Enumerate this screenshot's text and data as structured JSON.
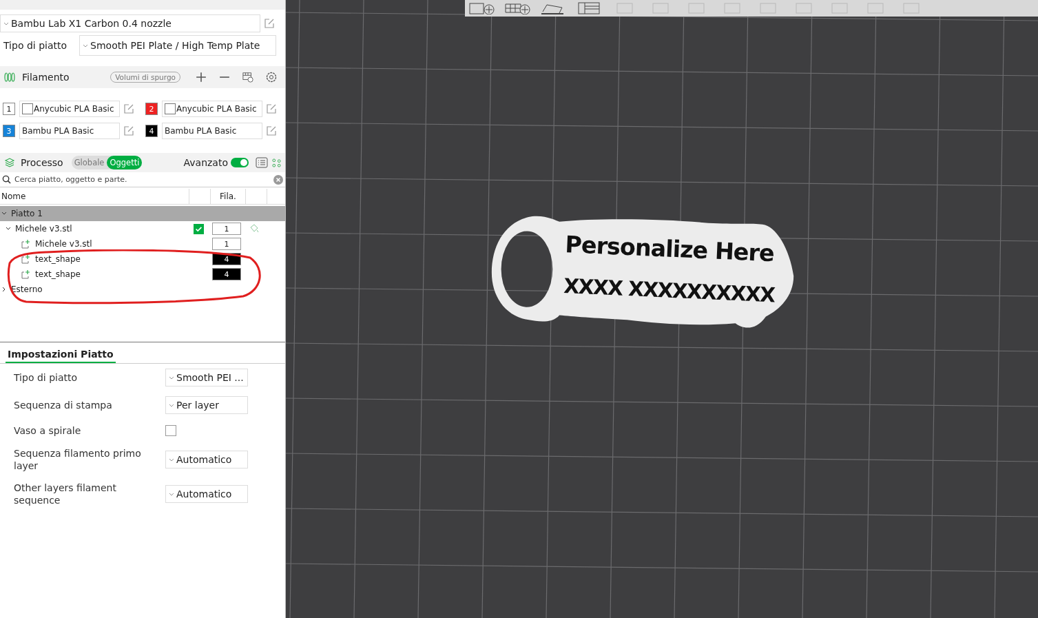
{
  "printer": {
    "value": "Bambu Lab X1 Carbon 0.4 nozzle"
  },
  "plate_type": {
    "label": "Tipo di piatto",
    "value": "Smooth PEI Plate / High Temp Plate"
  },
  "filament": {
    "title": "Filamento",
    "purge_button": "Volumi di spurgo",
    "slots": [
      {
        "number": "1",
        "color": "#ffffff",
        "name": "Anycubic PLA Basic",
        "kind": "swatch"
      },
      {
        "number": "2",
        "color": "#ee2222",
        "name": "Anycubic PLA Basic",
        "kind": "swatch"
      },
      {
        "number": "3",
        "color": "#1683d8",
        "name": "Bambu PLA Basic",
        "kind": "plain"
      },
      {
        "number": "4",
        "color": "#000000",
        "name": "Bambu PLA Basic",
        "kind": "plain"
      }
    ]
  },
  "process": {
    "title": "Processo",
    "tabs": [
      {
        "label": "Globale",
        "selected": false
      },
      {
        "label": "Oggetti",
        "selected": true
      }
    ],
    "advanced": {
      "label": "Avanzato",
      "on": true
    }
  },
  "search": {
    "placeholder": "Cerca piatto, oggetto e parte."
  },
  "table": {
    "columns": [
      "Nome",
      "Fila."
    ],
    "tree": [
      {
        "label": "Piatto 1",
        "expanded": true,
        "children": [
          {
            "label": "Michele v3.stl",
            "expanded": true,
            "visible": true,
            "filament": "1",
            "color": "#ffffff",
            "children": [
              {
                "label": "Michele v3.stl",
                "filament": "1",
                "color": "#ffffff"
              },
              {
                "label": "text_shape",
                "filament": "4",
                "color": "#000000"
              },
              {
                "label": "text_shape",
                "filament": "4",
                "color": "#000000"
              }
            ]
          }
        ]
      },
      {
        "label": "Esterno",
        "expanded": false
      }
    ]
  },
  "settings": {
    "tab": "Impostazioni Piatto",
    "rows": [
      {
        "kind": "select",
        "label": "Tipo di piatto",
        "value": "Smooth PEI ..."
      },
      {
        "kind": "select",
        "label": "Sequenza di stampa",
        "value": "Per layer"
      },
      {
        "kind": "checkbox",
        "label": "Vaso a spirale",
        "checked": false
      },
      {
        "kind": "select",
        "label": "Sequenza filamento primo layer",
        "value": "Automatico"
      },
      {
        "kind": "select",
        "label": "Other layers filament sequence",
        "value": "Automatico"
      }
    ]
  },
  "viewport": {
    "model_lines": [
      "Personalize Here",
      "XXXX XXXXXXXXXX"
    ]
  }
}
